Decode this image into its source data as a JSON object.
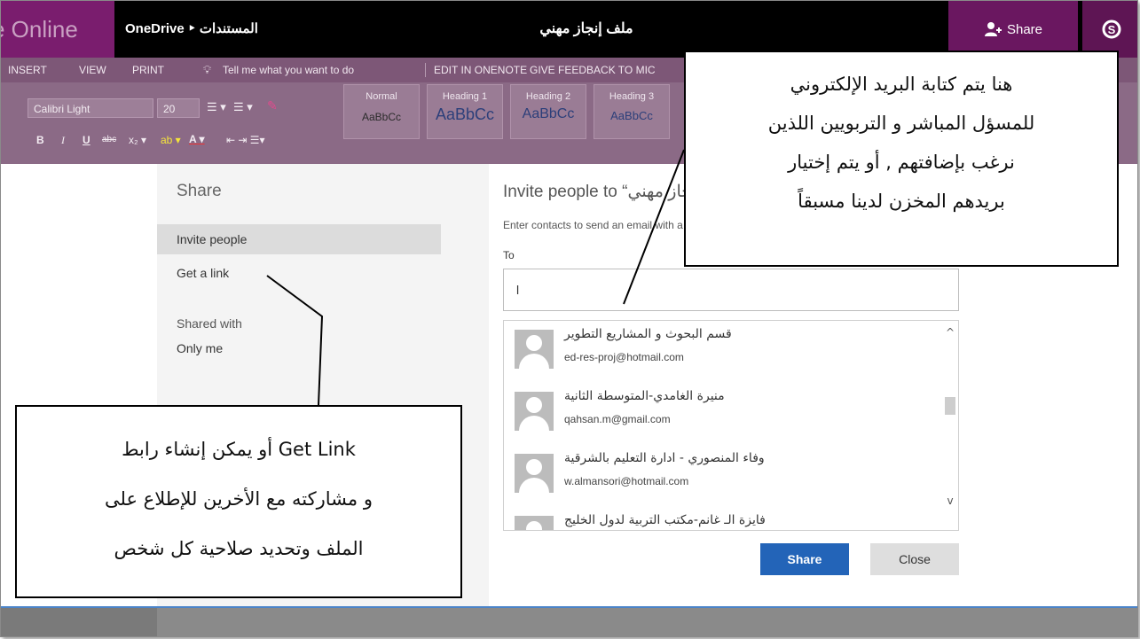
{
  "titlebar": {
    "app_name": "e Online",
    "breadcrumb": "OneDrive ‣ المستندات",
    "doc_title": "ملف إنجاز مهني",
    "share_button": "Share"
  },
  "menu": {
    "items": [
      "INSERT",
      "VIEW",
      "PRINT",
      "Tell me what you want to do",
      "EDIT IN ONENOTE",
      "GIVE FEEDBACK TO MIC"
    ]
  },
  "ribbon": {
    "font_name": "Calibri Light",
    "font_size": "20",
    "styles": [
      {
        "name": "Normal",
        "preview": "AaBbCc"
      },
      {
        "name": "Heading 1",
        "preview": "AaBbCc"
      },
      {
        "name": "Heading 2",
        "preview": "AaBbCc"
      },
      {
        "name": "Heading 3",
        "preview": "AaBbCc"
      }
    ]
  },
  "share_panel": {
    "title": "Share",
    "invite_people": "Invite people",
    "get_link": "Get a link",
    "shared_with_label": "Shared with",
    "shared_with_value": "Only me"
  },
  "invite": {
    "title": "Invite people to “ملف إنجاز مهني”",
    "subtitle": "Enter contacts to send an email with a link to this item.",
    "to_label": "To",
    "to_value": "l",
    "contacts": [
      {
        "name": "قسم البحوث و المشاريع التطوير",
        "email": "ed-res-proj@hotmail.com"
      },
      {
        "name": "منيرة الغامدي-المتوسطة الثانية",
        "email": "qahsan.m@gmail.com"
      },
      {
        "name": "وفاء المنصوري - ادارة التعليم بالشرقية",
        "email": "w.almansori@hotmail.com"
      },
      {
        "name": "فايزة الـ غانم-مكتب التربية لدول الخليج",
        "email": ""
      }
    ],
    "share_button": "Share",
    "close_button": "Close"
  },
  "callouts": {
    "top_right": [
      "هنا يتم كتابة البريد الإلكتروني",
      "للمسؤل المباشر و التربويين اللذين",
      "نرغب بإضافتهم , أو يتم إختيار",
      "بريدهم المخزن لدينا مسبقاً"
    ],
    "bottom_left": [
      "أو يمكن إنشاء رابط Get Link",
      "و مشاركته مع الأخرين للإطلاع على",
      "الملف  وتحديد صلاحية كل شخص"
    ]
  },
  "colors": {
    "app_purple": "#7a1d6e",
    "ribbon_purple": "#8b6a86",
    "share_blue": "#2364b8"
  }
}
